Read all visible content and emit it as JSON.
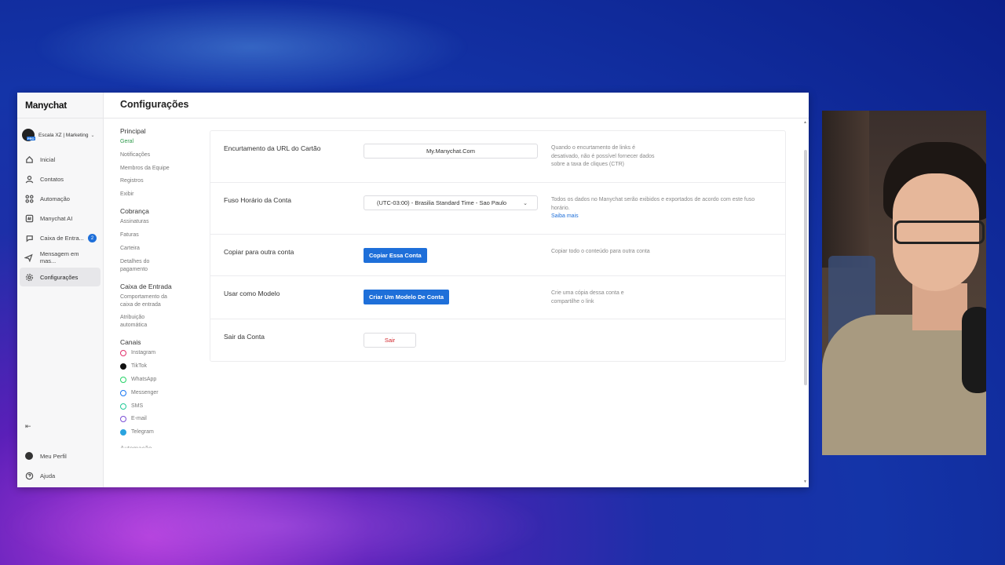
{
  "app": {
    "logo": "Manychat",
    "account_name": "Escala XZ | Marketing",
    "account_badge": "PRO",
    "page_title": "Configurações"
  },
  "sidebar": {
    "items": [
      {
        "label": "Inicial",
        "icon": "home-icon"
      },
      {
        "label": "Contatos",
        "icon": "contacts-icon"
      },
      {
        "label": "Automação",
        "icon": "automation-icon"
      },
      {
        "label": "Manychat AI",
        "icon": "ai-icon"
      },
      {
        "label": "Caixa de Entra...",
        "icon": "inbox-icon",
        "badge": "2"
      },
      {
        "label": "Mensagem em mas...",
        "icon": "broadcast-icon"
      },
      {
        "label": "Configurações",
        "icon": "gear-icon",
        "active": true
      }
    ],
    "bottom": [
      {
        "label": "Meu Perfil",
        "icon": "avatar"
      },
      {
        "label": "Ajuda",
        "icon": "help-icon"
      }
    ]
  },
  "settings_nav": {
    "sections": [
      {
        "title": "Principal",
        "items": [
          "Geral",
          "Notificações",
          "Membros da Equipe",
          "Registros",
          "Exibir"
        ]
      },
      {
        "title": "Cobrança",
        "items": [
          "Assinaturas",
          "Faturas",
          "Carteira",
          "Detalhes do pagamento"
        ]
      },
      {
        "title": "Caixa de Entrada",
        "items": [
          "Comportamento da caixa de entrada",
          "Atribuição automática"
        ]
      },
      {
        "title": "Canais",
        "items": [
          "Instagram",
          "TikTok",
          "WhatsApp",
          "Messenger",
          "SMS",
          "E-mail",
          "Telegram"
        ]
      }
    ],
    "active_item": "Geral",
    "cut_off_section": "Automação"
  },
  "settings": {
    "url_shortening": {
      "label": "Encurtamento da URL do Cartão",
      "value": "My.Manychat.Com",
      "desc": "Quando o encurtamento de links é desativado, não é possível fornecer dados sobre a taxa de cliques (CTR)"
    },
    "timezone": {
      "label": "Fuso Horário da Conta",
      "value": "(UTC-03:00) - Brasilia Standard Time - Sao Paulo",
      "desc": "Todos os dados no Manychat serão exibidos e exportados de acordo com este fuso horário.",
      "link": "Saiba mais"
    },
    "copy_account": {
      "label": "Copiar para outra conta",
      "button": "Copiar Essa Conta",
      "desc": "Copiar todo o conteúdo para outra conta"
    },
    "use_as_template": {
      "label": "Usar como Modelo",
      "button": "Criar Um Modelo De Conta",
      "desc": "Crie uma cópia dessa conta e compartilhe o link"
    },
    "logout": {
      "label": "Sair da Conta",
      "button": "Sair"
    }
  },
  "colors": {
    "accent": "#1e6fd9",
    "active_green": "#2e9a4b",
    "danger": "#d2282e",
    "channel_instagram": "#e1306c",
    "channel_tiktok": "#111111",
    "channel_whatsapp": "#25d366",
    "channel_messenger": "#1877f2",
    "channel_sms": "#20c997",
    "channel_email": "#7b4fd6",
    "channel_telegram": "#2aa3df"
  }
}
